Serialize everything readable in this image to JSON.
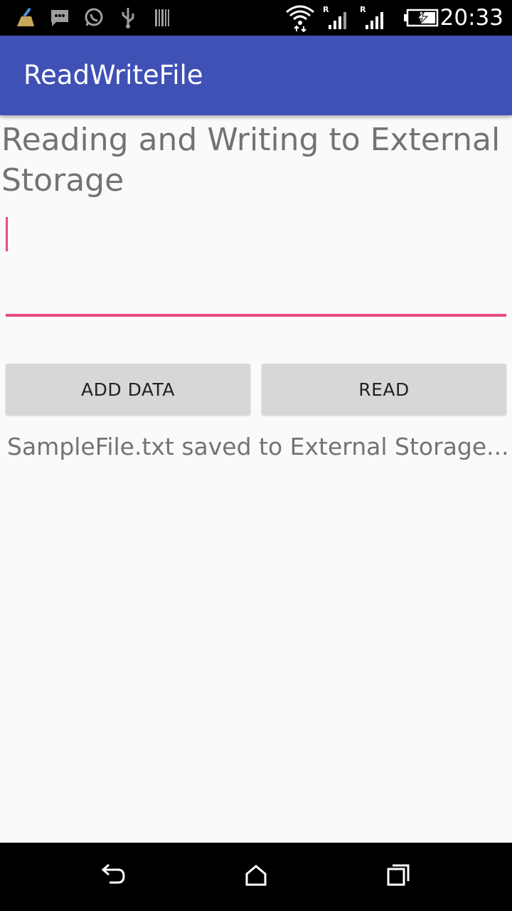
{
  "status_bar": {
    "time": "20:33",
    "icons": [
      "cleaner-icon",
      "chat-icon",
      "whatsapp-icon",
      "usb-icon",
      "barcode-icon",
      "wifi-icon",
      "signal-r-icon",
      "signal-r-icon",
      "battery-charging-icon"
    ]
  },
  "app_bar": {
    "title": "ReadWriteFile",
    "color": "#3f51b5"
  },
  "content": {
    "heading": "Reading and Writing to External Storage",
    "input_value": "",
    "accent_color": "#e84a84",
    "add_button_label": "ADD DATA",
    "read_button_label": "READ",
    "status_message": "SampleFile.txt saved to External Storage..."
  },
  "nav_bar": {
    "buttons": [
      "back-icon",
      "home-icon",
      "recents-icon"
    ]
  }
}
